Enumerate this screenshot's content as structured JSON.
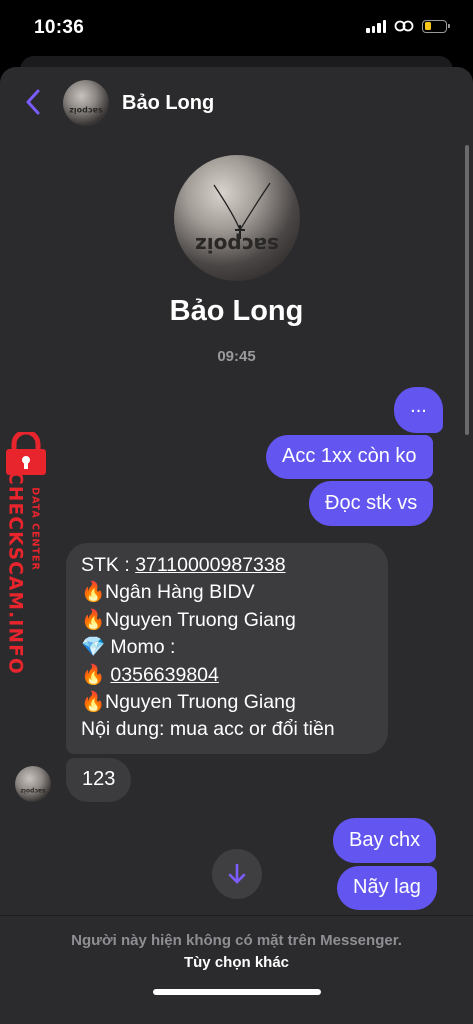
{
  "status_bar": {
    "time": "10:36",
    "battery_level": 0.3,
    "battery_color": "#f5c518",
    "icons": [
      "signal-icon",
      "personal-hotspot-icon",
      "battery-icon"
    ]
  },
  "header": {
    "contact_name": "Bảo Long"
  },
  "profile": {
    "name": "Bảo Long",
    "avatar_text": "sacpoiz"
  },
  "conversation": {
    "timestamp": "09:45",
    "outgoing_top": [
      {
        "text": "..."
      },
      {
        "text": "Acc 1xx còn ko"
      },
      {
        "text": "Đọc stk vs"
      }
    ],
    "incoming_info": {
      "stk_label": "STK : ",
      "stk_number": "37110000987338",
      "bank_emoji": "🔥",
      "bank": "Ngân Hàng BIDV",
      "name1_emoji": "🔥",
      "name1": "Nguyen Truong Giang",
      "momo_emoji": "💎",
      "momo_label": " Momo :",
      "phone_emoji": "🔥",
      "phone": "0356639804",
      "name2_emoji": "🔥",
      "name2": "Nguyen Truong Giang",
      "content": "Nội dung: mua acc or đổi tiền"
    },
    "incoming_short": {
      "text": "123"
    },
    "outgoing_bottom": [
      {
        "text": "Bay chx"
      },
      {
        "text": "Nãy lag"
      }
    ]
  },
  "footer": {
    "note": "Người này hiện không có mặt trên Messenger.",
    "link": "Tùy chọn khác"
  },
  "watermark": {
    "main": "CHECKSCAM.INFO",
    "sub": "DATA CENTER"
  },
  "colors": {
    "outgoing_bubble": "#6356f0",
    "incoming_bubble": "#3c3c3f",
    "accent": "#7c5cff",
    "watermark": "#e8242c"
  }
}
